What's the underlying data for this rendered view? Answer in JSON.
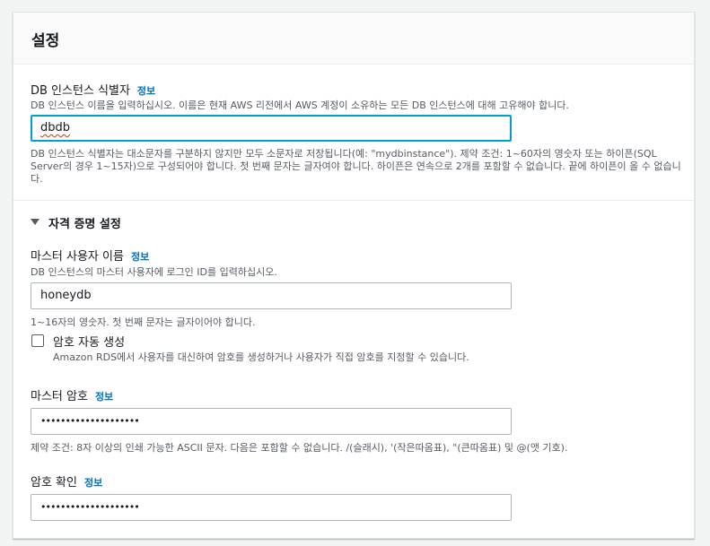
{
  "settings": {
    "title": "설정",
    "db_identifier": {
      "label": "DB 인스턴스 식별자",
      "info": "정보",
      "description": "DB 인스턴스 이름을 입력하십시오. 이름은 현재 AWS 리전에서 AWS 계정이 소유하는 모든 DB 인스턴스에 대해 고유해야 합니다.",
      "value": "dbdb",
      "constraints": "DB 인스턴스 식별자는 대소문자를 구분하지 않지만 모두 소문자로 저장됩니다(예: \"mydbinstance\"). 제약 조건: 1~60자의 영숫자 또는 하이픈(SQL Server의 경우 1~15자)으로 구성되어야 합니다. 첫 번째 문자는 글자여야 합니다. 하이픈은 연속으로 2개를 포함할 수 없습니다. 끝에 하이픈이 올 수 없습니다."
    },
    "credentials": {
      "title": "자격 증명 설정",
      "master_username": {
        "label": "마스터 사용자 이름",
        "info": "정보",
        "description": "DB 인스턴스의 마스터 사용자에 로그인 ID를 입력하십시오.",
        "value": "honeydb",
        "constraints": "1~16자의 영숫자. 첫 번째 문자는 글자이어야 합니다."
      },
      "auto_generate": {
        "label": "암호 자동 생성",
        "description": "Amazon RDS에서 사용자를 대신하여 암호를 생성하거나 사용자가 직접 암호를 지정할 수 있습니다.",
        "checked": false
      },
      "master_password": {
        "label": "마스터 암호",
        "info": "정보",
        "value": "••••••••••••••••••••",
        "constraints": "제약 조건: 8자 이상의 인쇄 가능한 ASCII 문자. 다음은 포함할 수 없습니다. /(슬래시), '(작은따옴표), \"(큰따옴표) 및 @(앳 기호)."
      },
      "confirm_password": {
        "label": "암호 확인",
        "info": "정보",
        "value": "••••••••••••••••••••"
      }
    }
  }
}
